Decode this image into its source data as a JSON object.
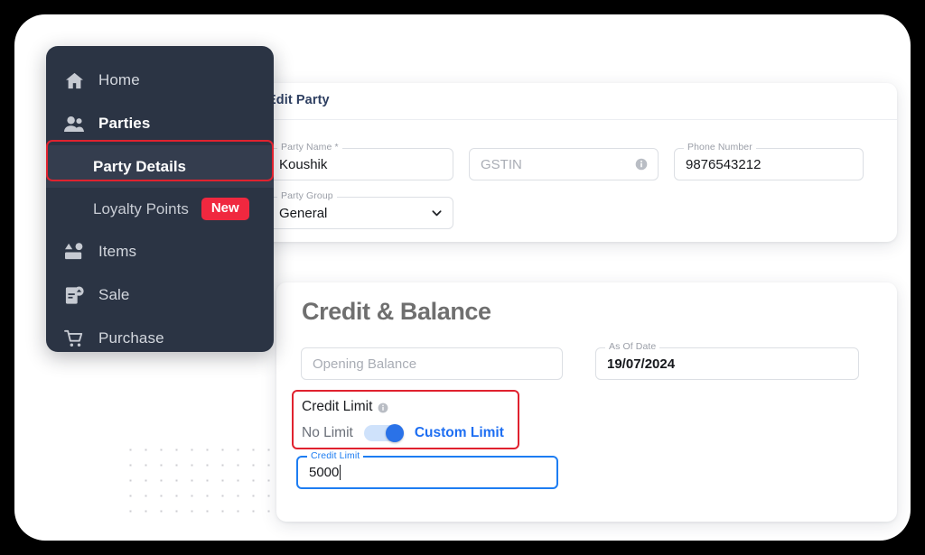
{
  "sidebar": {
    "items": [
      {
        "label": "Home",
        "icon": "home-icon",
        "type": "top",
        "bold": false
      },
      {
        "label": "Parties",
        "icon": "people-icon",
        "type": "top",
        "bold": true
      },
      {
        "label": "Party Details",
        "icon": "",
        "type": "sub",
        "bold": true,
        "active": true
      },
      {
        "label": "Loyalty Points",
        "icon": "",
        "type": "sub",
        "bold": false,
        "badge": "New"
      },
      {
        "label": "Items",
        "icon": "items-icon",
        "type": "top",
        "bold": false
      },
      {
        "label": "Sale",
        "icon": "sale-icon",
        "type": "top",
        "bold": false
      },
      {
        "label": "Purchase",
        "icon": "cart-icon",
        "type": "top",
        "bold": false
      }
    ],
    "badge_new": "New",
    "active_highlight_color": "#e0222f"
  },
  "edit_party": {
    "title": "Edit Party",
    "fields": {
      "party_name": {
        "label": "Party Name *",
        "value": "Koushik",
        "placeholder": ""
      },
      "gstin": {
        "label": "",
        "value": "",
        "placeholder": "GSTIN"
      },
      "phone_number": {
        "label": "Phone Number",
        "value": "9876543212",
        "placeholder": ""
      },
      "party_group": {
        "label": "Party Group",
        "value": "General",
        "placeholder": ""
      }
    }
  },
  "credit_balance": {
    "title": "Credit & Balance",
    "opening_balance": {
      "label": "",
      "value": "",
      "placeholder": "Opening Balance"
    },
    "as_of_date": {
      "label": "As Of Date",
      "value": "19/07/2024",
      "placeholder": ""
    },
    "credit_limit_toggle": {
      "heading": "Credit Limit",
      "off_label": "No Limit",
      "on_label": "Custom Limit",
      "state": "Custom Limit",
      "on_color": "#1d6ef2"
    },
    "credit_limit_input": {
      "label": "Credit Limit",
      "value": "5000",
      "placeholder": "",
      "focused": true,
      "focus_color": "#1d7df2"
    }
  },
  "theme": {
    "frame_bg": "#000000",
    "card_bg": "#ffffff",
    "sidebar_bg": "#2b3444",
    "sidebar_active_bg": "#343d4e",
    "accent_red": "#e0222f",
    "badge_red": "#f0283f",
    "accent_blue": "#1d7df2",
    "title_navy": "#2e3f61",
    "heading_gray": "#6f6f6f"
  }
}
